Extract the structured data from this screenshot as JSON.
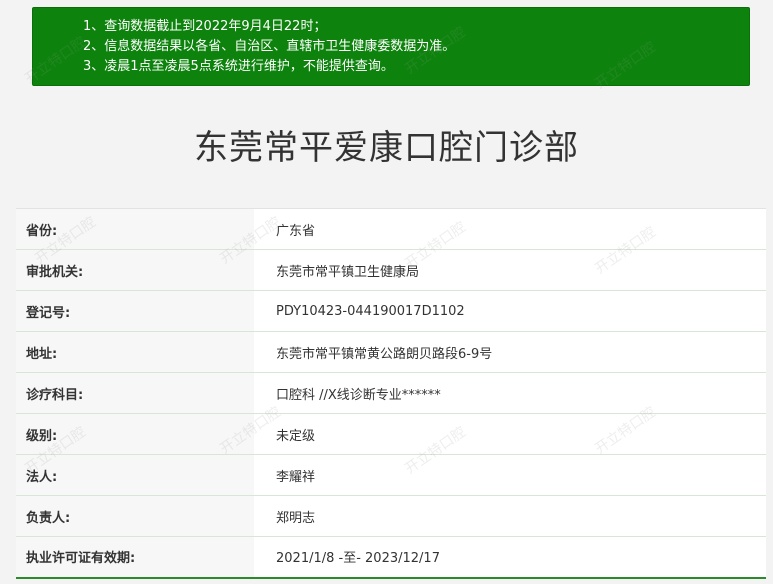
{
  "notice": {
    "lines": [
      "1、查询数据截止到2022年9月4日22时；",
      "2、信息数据结果以各省、自治区、直辖市卫生健康委数据为准。",
      "3、凌晨1点至凌晨5点系统进行维护，不能提供查询。"
    ]
  },
  "page_title": "东莞常平爱康口腔门诊部",
  "info": [
    {
      "label": "省份:",
      "value": "广东省"
    },
    {
      "label": "审批机关:",
      "value": "东莞市常平镇卫生健康局"
    },
    {
      "label": "登记号:",
      "value": "PDY10423-044190017D1102"
    },
    {
      "label": "地址:",
      "value": "东莞市常平镇常黄公路朗贝路段6-9号"
    },
    {
      "label": "诊疗科目:",
      "value": "口腔科 //X线诊断专业******"
    },
    {
      "label": "级别:",
      "value": "未定级"
    },
    {
      "label": "法人:",
      "value": "李耀祥"
    },
    {
      "label": "负责人:",
      "value": "郑明志"
    },
    {
      "label": "执业许可证有效期:",
      "value": "2021/1/8 -至- 2023/12/17"
    }
  ],
  "watermark_text": "开立特口腔"
}
